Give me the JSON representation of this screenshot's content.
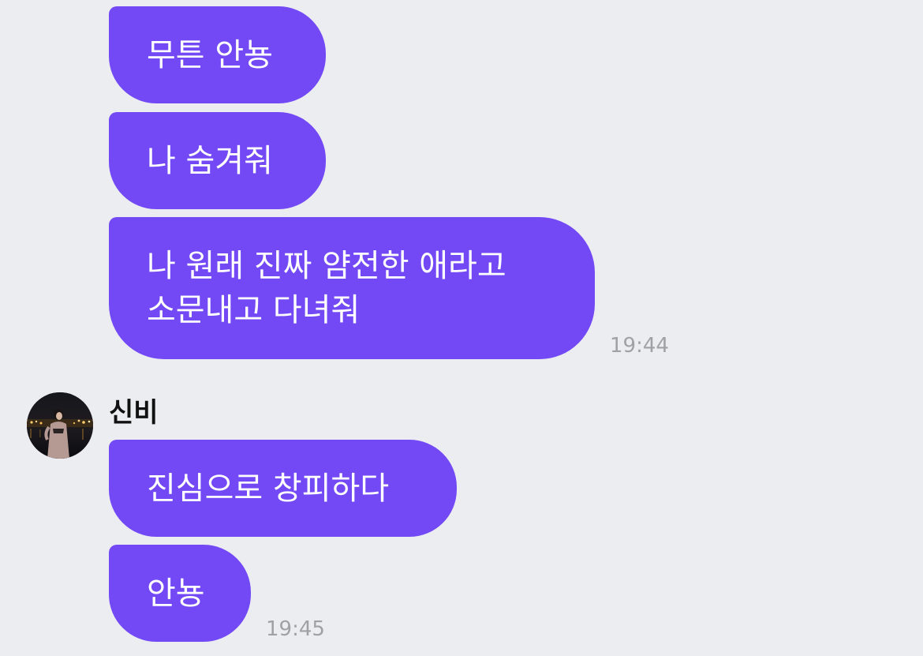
{
  "messages_group_1": [
    {
      "lines": [
        "무튼 안뇽"
      ]
    },
    {
      "lines": [
        "나 숨겨줘"
      ]
    },
    {
      "lines": [
        "나 원래 진짜 얌전한 애라고",
        "소문내고 다녀줘"
      ]
    }
  ],
  "group_1_time": "19:44",
  "sender": {
    "name": "신비",
    "avatar_icon": "profile-photo"
  },
  "messages_group_2": [
    {
      "lines": [
        "진심으로 창피하다"
      ]
    },
    {
      "lines": [
        "안뇽"
      ]
    }
  ],
  "group_2_time": "19:45",
  "colors": {
    "background": "#ECEDF1",
    "bubble": "#7349F5",
    "bubble_text": "#FFFFFF",
    "timestamp": "#A0A1A6",
    "sender_name": "#111111"
  }
}
